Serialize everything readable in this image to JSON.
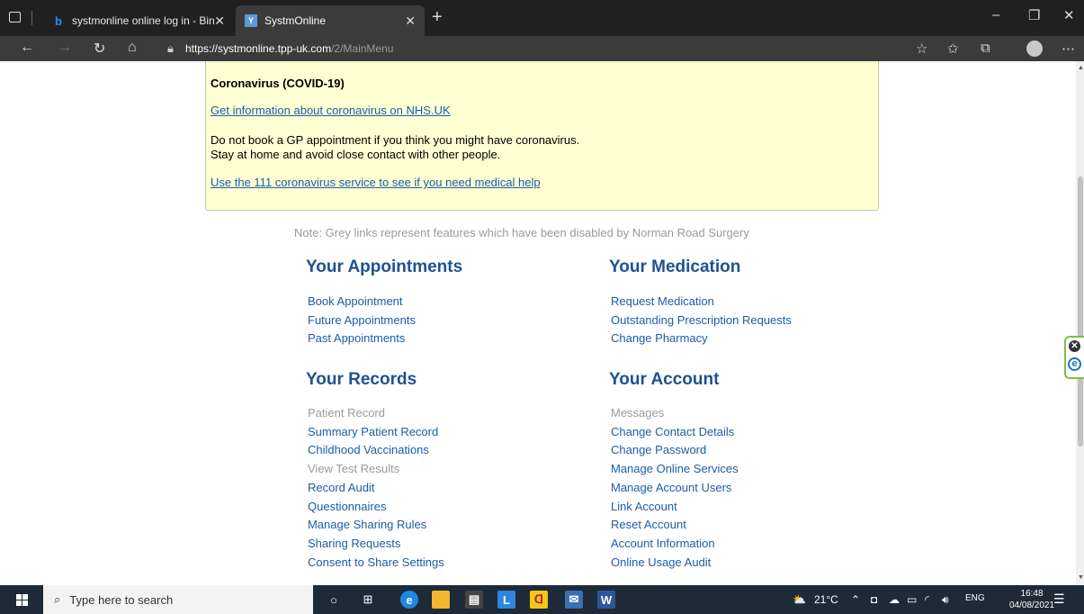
{
  "browser": {
    "tabs": [
      {
        "title": "systmonline online log in - Bing",
        "favicon": "bing-icon",
        "active": false
      },
      {
        "title": "SystmOnline",
        "favicon": "tpp-icon",
        "active": true
      }
    ],
    "url_host": "https://systmonline.tpp-uk.com",
    "url_path": "/2/MainMenu"
  },
  "covid": {
    "title": "Coronavirus (COVID-19)",
    "link1": "Get information about coronavirus on NHS.UK",
    "text_line1": "Do not book a GP appointment if you think you might have coronavirus.",
    "text_line2": "Stay at home and avoid close contact with other people.",
    "link2": "Use the 111 coronavirus service to see if you need medical help"
  },
  "note": "Note: Grey links represent features which have been disabled by Norman Road Surgery",
  "sections": {
    "appointments": {
      "heading": "Your Appointments",
      "links": [
        "Book Appointment",
        "Future Appointments",
        "Past Appointments"
      ]
    },
    "medication": {
      "heading": "Your Medication",
      "links": [
        "Request Medication",
        "Outstanding Prescription Requests",
        "Change Pharmacy"
      ]
    },
    "records": {
      "heading": "Your Records",
      "links": [
        "Patient Record",
        "Summary Patient Record",
        "Childhood Vaccinations",
        "View Test Results",
        "Record Audit",
        "Questionnaires",
        "Manage Sharing Rules",
        "Sharing Requests",
        "Consent to Share Settings"
      ],
      "disabled": [
        0,
        3
      ]
    },
    "account": {
      "heading": "Your Account",
      "links": [
        "Messages",
        "Change Contact Details",
        "Change Password",
        "Manage Online Services",
        "Manage Account Users",
        "Link Account",
        "Reset Account",
        "Account Information",
        "Online Usage Audit"
      ],
      "disabled": [
        0
      ]
    }
  },
  "taskbar": {
    "search_placeholder": "Type here to search",
    "weather": "21°C",
    "language": "ENG",
    "time": "16:48",
    "date": "04/08/2021"
  },
  "colors": {
    "link": "#1a5ea8",
    "heading": "#1f5192",
    "disabled": "#9a9a9a",
    "covid_bg": "#ffffd4",
    "frame_accent": "#7cc242"
  }
}
